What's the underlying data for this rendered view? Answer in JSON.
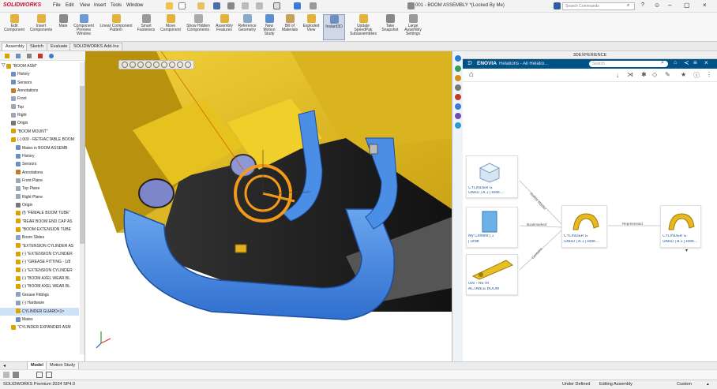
{
  "app": {
    "name": "SOLIDWORKS",
    "document_title": "001 - BOOM ASSEMBLY *(Locked By Me)",
    "search_placeholder": "Search Commands"
  },
  "menu": [
    "File",
    "Edit",
    "View",
    "Insert",
    "Tools",
    "Window"
  ],
  "command_manager": [
    {
      "label": "Edit Component",
      "icon": "edit-component-icon"
    },
    {
      "label": "Insert Components",
      "icon": "insert-components-icon"
    },
    {
      "label": "Mate",
      "icon": "mate-icon"
    },
    {
      "label": "Component Preview Window",
      "icon": "preview-window-icon"
    },
    {
      "label": "Linear Component Pattern",
      "icon": "linear-pattern-icon"
    },
    {
      "label": "Smart Fasteners",
      "icon": "smart-fasteners-icon"
    },
    {
      "label": "Move Component",
      "icon": "move-component-icon"
    },
    {
      "label": "Show Hidden Components",
      "icon": "show-hidden-icon"
    },
    {
      "label": "Assembly Features",
      "icon": "assembly-features-icon"
    },
    {
      "label": "Reference Geometry",
      "icon": "reference-geometry-icon"
    },
    {
      "label": "New Motion Study",
      "icon": "motion-study-icon"
    },
    {
      "label": "Bill of Materials",
      "icon": "bom-icon"
    },
    {
      "label": "Exploded View",
      "icon": "exploded-view-icon"
    },
    {
      "label": "Instant3D",
      "icon": "instant3d-icon",
      "active": true
    },
    {
      "label": "Update SpeedPak Subassemblies",
      "icon": "speedpak-icon"
    },
    {
      "label": "Take Snapshot",
      "icon": "snapshot-icon"
    },
    {
      "label": "Large Assembly Settings",
      "icon": "large-assembly-icon"
    }
  ],
  "tabs": [
    "Assembly",
    "Sketch",
    "Evaluate",
    "SOLIDWORKS Add-Ins"
  ],
  "tree": [
    {
      "label": "\"BOOM ASM\"",
      "indent": 0,
      "color": "#d9a400"
    },
    {
      "label": "History",
      "indent": 1,
      "color": "#6a8fc0"
    },
    {
      "label": "Sensors",
      "indent": 1,
      "color": "#6a8fc0"
    },
    {
      "label": "Annotations",
      "indent": 1,
      "color": "#c07a2a"
    },
    {
      "label": "Front",
      "indent": 1,
      "color": "#9aa7b8"
    },
    {
      "label": "Top",
      "indent": 1,
      "color": "#9aa7b8"
    },
    {
      "label": "Right",
      "indent": 1,
      "color": "#9aa7b8"
    },
    {
      "label": "Origin",
      "indent": 1,
      "color": "#777"
    },
    {
      "label": "\"BOOM MOUNT\"",
      "indent": 1,
      "color": "#d9a400"
    },
    {
      "label": "(-) 000 - RETRACTABLE BOOM",
      "indent": 1,
      "color": "#d9a400"
    },
    {
      "label": "Mates in BOOM ASSEMB",
      "indent": 2,
      "color": "#6a8fc0"
    },
    {
      "label": "History",
      "indent": 2,
      "color": "#6a8fc0"
    },
    {
      "label": "Sensors",
      "indent": 2,
      "color": "#6a8fc0"
    },
    {
      "label": "Annotations",
      "indent": 2,
      "color": "#c07a2a"
    },
    {
      "label": "Front Plane",
      "indent": 2,
      "color": "#9aa7b8"
    },
    {
      "label": "Top Plane",
      "indent": 2,
      "color": "#9aa7b8"
    },
    {
      "label": "Right Plane",
      "indent": 2,
      "color": "#9aa7b8"
    },
    {
      "label": "Origin",
      "indent": 2,
      "color": "#777"
    },
    {
      "label": "(f) \"FEMALE BOOM TUBE\"",
      "indent": 2,
      "color": "#d9a400"
    },
    {
      "label": "\"REAR BOOM END CAP AS",
      "indent": 2,
      "color": "#d9a400"
    },
    {
      "label": "\"BOOM EXTENSION TUBE",
      "indent": 2,
      "color": "#d9a400"
    },
    {
      "label": "Boom Slides",
      "indent": 2,
      "color": "#8aa0c0"
    },
    {
      "label": "\"EXTENSION CYLINDER AS",
      "indent": 2,
      "color": "#d9a400"
    },
    {
      "label": "(-) \"EXTENSION CYLINDER",
      "indent": 2,
      "color": "#d9a400"
    },
    {
      "label": "(-) \"GREASE FITTING - 1/8",
      "indent": 2,
      "color": "#d9a400"
    },
    {
      "label": "(-) \"EXTENSION CYLINDER",
      "indent": 2,
      "color": "#d9a400"
    },
    {
      "label": "(-) \"BOOM AXEL WEAR BL",
      "indent": 2,
      "color": "#d9a400"
    },
    {
      "label": "(-) \"BOOM AXEL WEAR BL",
      "indent": 2,
      "color": "#d9a400"
    },
    {
      "label": "Grease Fittings",
      "indent": 2,
      "color": "#8aa0c0"
    },
    {
      "label": "(-) Hardware",
      "indent": 2,
      "color": "#8aa0c0"
    },
    {
      "label": "CYLINDER GUARD<1>",
      "indent": 2,
      "color": "#d9a400",
      "selected": true
    },
    {
      "label": "Mates",
      "indent": 2,
      "color": "#6a8fc0"
    },
    {
      "label": "\"CYLINDER EXPANDER ASM",
      "indent": 1,
      "color": "#d9a400"
    }
  ],
  "bottom_tabs": [
    "Model",
    "Motion Study"
  ],
  "status": {
    "product": "SOLIDWORKS Premium 2024 SP4.0",
    "definition": "Under Defined",
    "mode": "Editing Assembly",
    "units": "Custom"
  },
  "panel": {
    "header": "3DEXPERIENCE",
    "app": "ENOVIA",
    "title": "Relations - All Relatio...",
    "search_placeholder": "Search",
    "colors": {
      "enovia": "#005386",
      "link": "#2b5e9b"
    }
  },
  "graph": {
    "nodes": [
      {
        "id": "n1",
        "title": "CYLINDER G",
        "subtitle": "UARD | A.1 | Rele...",
        "icon": "cube-icon"
      },
      {
        "id": "n2",
        "title": "My Content | 1",
        "subtitle": "| Draft",
        "icon": "drawing-icon"
      },
      {
        "id": "n3",
        "title": "000 - RETR",
        "subtitle": "ACTABLE BOOM",
        "icon": "boom-part-icon"
      },
      {
        "id": "n4",
        "title": "CYLINDER G",
        "subtitle": "UARD | A.1 | Rele...",
        "icon": "guard-part-icon"
      },
      {
        "id": "n5",
        "title": "CYLINDER G",
        "subtitle": "UARD | A.1 | Rele...",
        "icon": "guard-part-icon"
      }
    ],
    "edges": [
      {
        "from": "n1",
        "to": "n4",
        "label": "Author Master"
      },
      {
        "from": "n2",
        "to": "n4",
        "label": "Bookmarked"
      },
      {
        "from": "n3",
        "to": "n4",
        "label": "Contains"
      },
      {
        "from": "n4",
        "to": "n5",
        "label": "Represented"
      }
    ]
  }
}
